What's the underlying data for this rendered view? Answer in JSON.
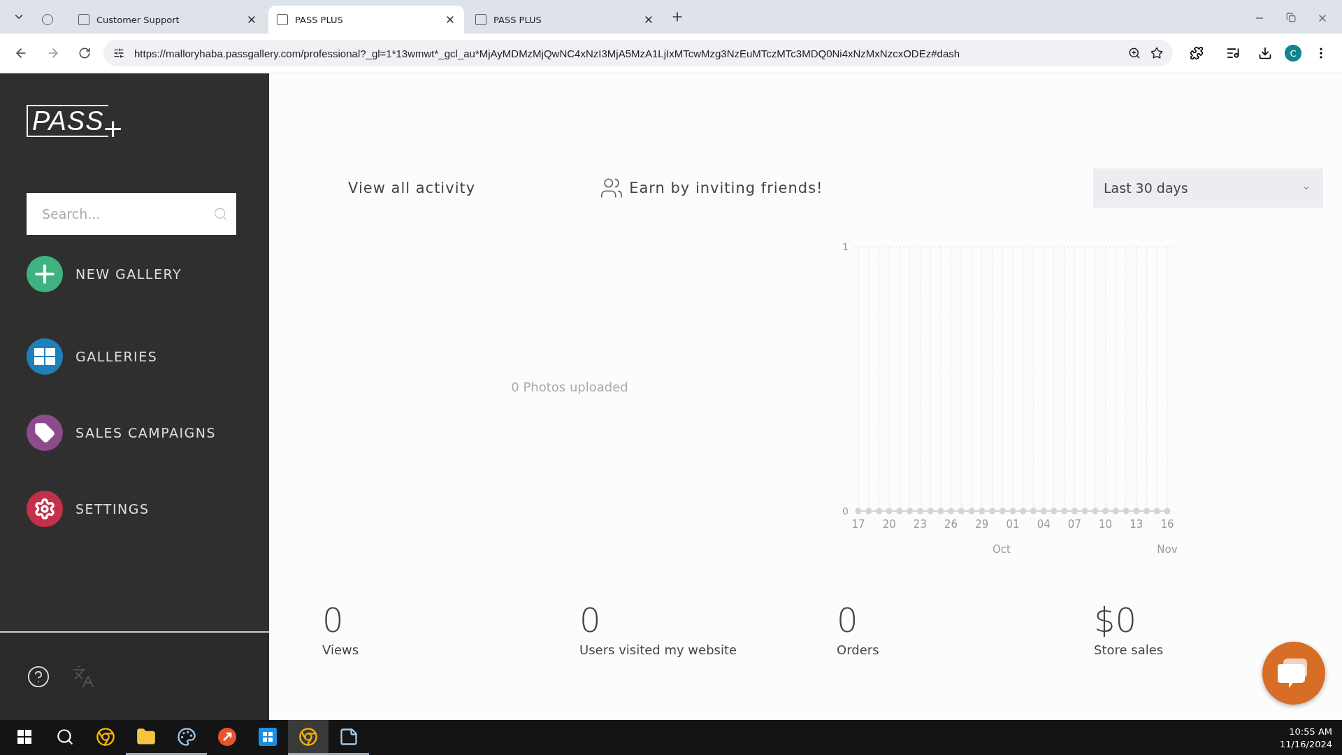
{
  "browser": {
    "tabs": [
      {
        "kind": "icon",
        "selected": false
      },
      {
        "kind": "page",
        "title": "Customer Support",
        "selected": false
      },
      {
        "kind": "page",
        "title": "PASS PLUS",
        "selected": true
      },
      {
        "kind": "page",
        "title": "PASS PLUS",
        "selected": false
      }
    ],
    "url": "https://malloryhaba.passgallery.com/professional?_gl=1*13wmwt*_gcl_au*MjAyMDMzMjQwNC4xNzI3MjA5MzA1LjIxMTcwMzg3NzEuMTczMTc3MDQ0Ni4xNzMxNzcxODEz#dash",
    "profile": "C"
  },
  "sidebar": {
    "logo": {
      "text": "PASS",
      "mark": "+"
    },
    "search": {
      "placeholder": "Search..."
    },
    "items": [
      {
        "kind": "new",
        "label": "NEW GALLERY",
        "color": "#3fb27f"
      },
      {
        "kind": "galleries",
        "label": "GALLERIES",
        "color": "#1f80b9"
      },
      {
        "kind": "campaigns",
        "label": "SALES CAMPAIGNS",
        "color": "#8b4b8d"
      },
      {
        "kind": "settings",
        "label": "SETTINGS",
        "color": "#c4304b"
      }
    ]
  },
  "main": {
    "links": [
      {
        "kind": "activity",
        "label": "View all activity"
      },
      {
        "kind": "invite",
        "label": "Earn by inviting friends!"
      }
    ],
    "range": {
      "value": "Last 30 days"
    },
    "photos": "0 Photos uploaded",
    "chart_data": {
      "type": "line",
      "categories": [
        "17",
        null,
        null,
        "20",
        null,
        null,
        "23",
        null,
        null,
        "26",
        null,
        null,
        "29",
        null,
        null,
        "01",
        null,
        null,
        "04",
        null,
        null,
        "07",
        null,
        null,
        "10",
        null,
        null,
        "13",
        null,
        null,
        "16"
      ],
      "series": [
        {
          "color": "#d4d4d4",
          "marker": "circle",
          "values": [
            0,
            0,
            0,
            0,
            0,
            0,
            0,
            0,
            0,
            0,
            0,
            0,
            0,
            0,
            0,
            0,
            0,
            0,
            0,
            0,
            0,
            0,
            0,
            0,
            0,
            0,
            0,
            0,
            0,
            0,
            0
          ]
        }
      ],
      "ylim": [
        0,
        1
      ],
      "yticks": [
        0,
        1
      ],
      "annotations": [
        {
          "text": "Oct"
        },
        {
          "text": "Nov"
        }
      ]
    },
    "stats": [
      {
        "value": "0",
        "label": "Views"
      },
      {
        "value": "0",
        "label": "Users visited my website"
      },
      {
        "value": "0",
        "label": "Orders"
      },
      {
        "value": "$0",
        "label": "Store sales"
      }
    ]
  },
  "taskbar": {
    "items": [
      {
        "kind": "start",
        "open": false,
        "selected": false
      },
      {
        "kind": "search",
        "open": false,
        "selected": false
      },
      {
        "kind": "chrome",
        "open": false,
        "selected": false
      },
      {
        "kind": "folder",
        "open": true,
        "selected": false
      },
      {
        "kind": "paint",
        "open": true,
        "selected": false
      },
      {
        "kind": "remote",
        "open": false,
        "selected": false
      },
      {
        "kind": "store",
        "open": false,
        "selected": false
      },
      {
        "kind": "chrome",
        "open": true,
        "selected": true
      },
      {
        "kind": "notes",
        "open": true,
        "selected": false
      }
    ],
    "time": "10:55 AM",
    "date": "11/16/2024"
  }
}
